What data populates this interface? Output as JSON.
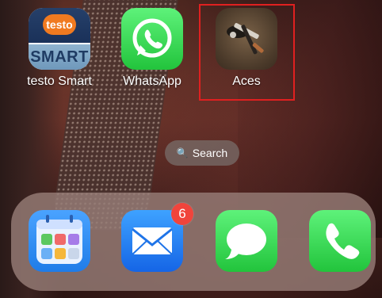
{
  "home_screen": {
    "apps": [
      {
        "label": "testo Smart",
        "icon_top_text": "testo",
        "icon_bottom_text": "SMART",
        "icon": "testo-smart-icon"
      },
      {
        "label": "WhatsApp",
        "icon": "whatsapp-icon"
      },
      {
        "label": "Aces",
        "icon": "aces-icon"
      }
    ],
    "search": {
      "label": "Search",
      "icon": "search-icon"
    },
    "highlight_color": "#e02020"
  },
  "dock": {
    "apps": [
      {
        "name": "Calendar widget app",
        "icon": "calendar-grid-icon"
      },
      {
        "name": "Mail",
        "icon": "mail-icon",
        "badge": "6"
      },
      {
        "name": "Messages",
        "icon": "messages-icon"
      },
      {
        "name": "Phone",
        "icon": "phone-icon"
      }
    ]
  },
  "colors": {
    "badge": "#f0443c",
    "testo_orange": "#f07a20",
    "whatsapp_green": "#25d366"
  }
}
